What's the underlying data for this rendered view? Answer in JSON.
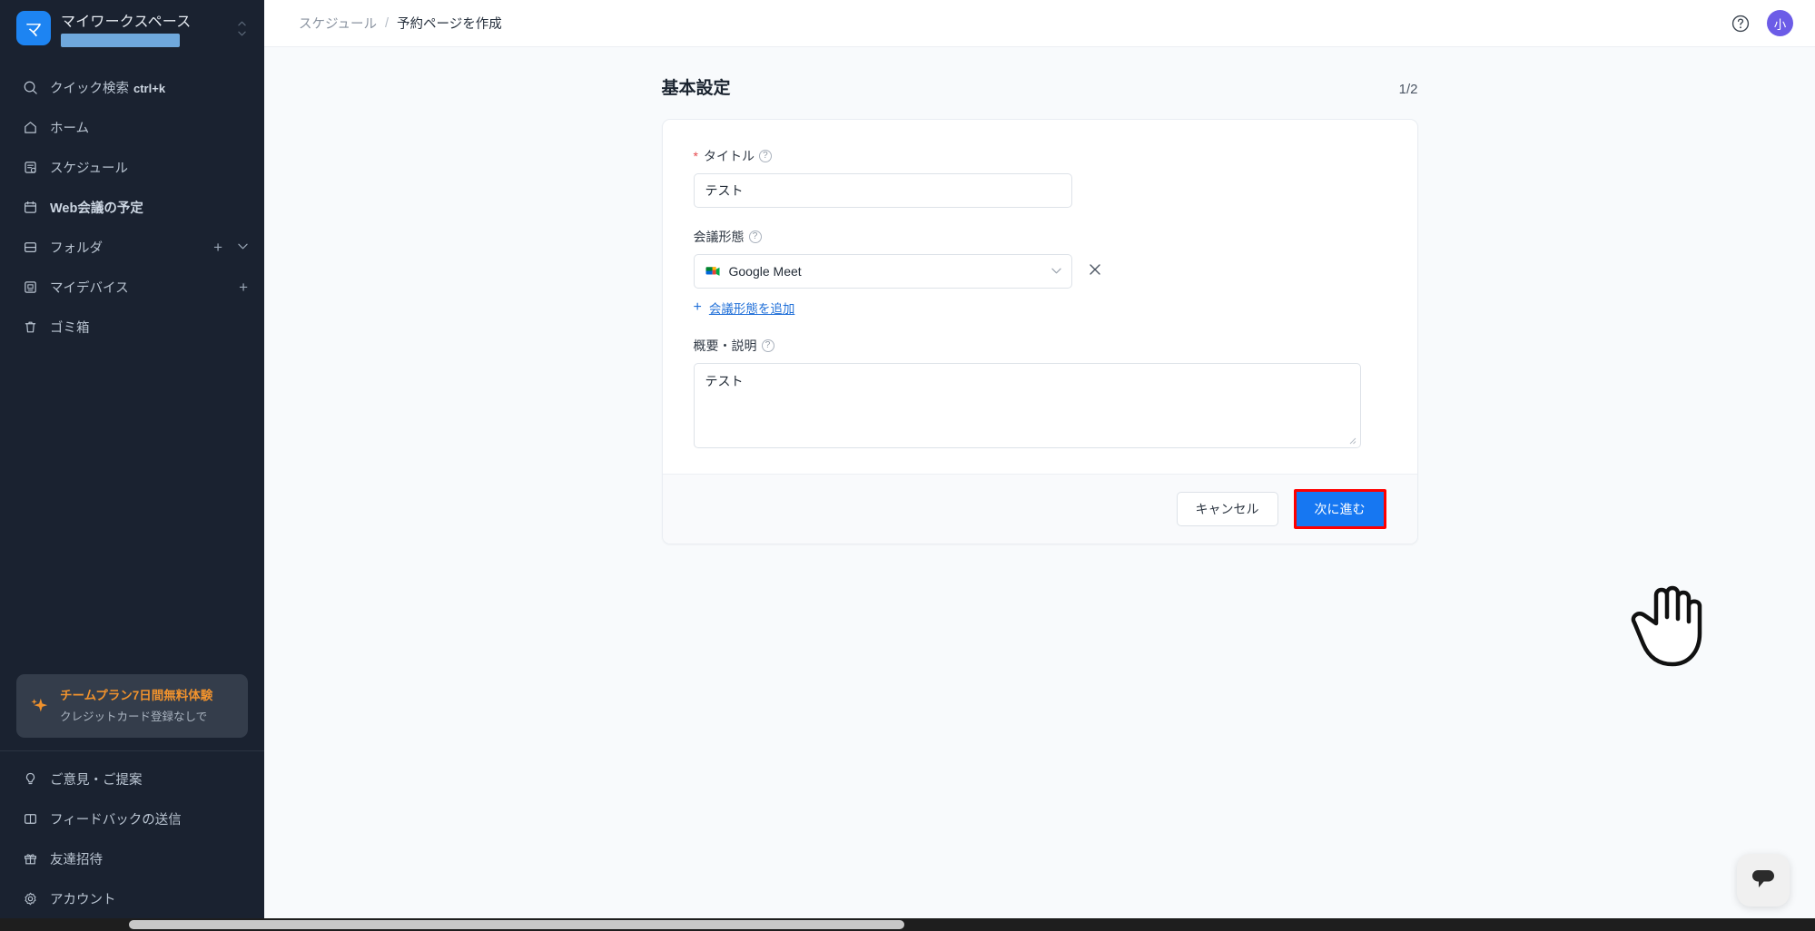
{
  "sidebar": {
    "workspace": {
      "logo_glyph": "マ",
      "name": "マイワークスペース",
      "redacted_bar": true,
      "collapse_icon": "chevron-updown-icon"
    },
    "items": [
      {
        "icon": "search-icon",
        "label": "クイック検索",
        "hint": "ctrl+k",
        "bold": false,
        "plus": false,
        "chevron": false
      },
      {
        "icon": "home-icon",
        "label": "ホーム",
        "hint": "",
        "bold": false,
        "plus": false,
        "chevron": false
      },
      {
        "icon": "schedule-icon",
        "label": "スケジュール",
        "hint": "",
        "bold": false,
        "plus": false,
        "chevron": false
      },
      {
        "icon": "calendar-icon",
        "label": "Web会議の予定",
        "hint": "",
        "bold": true,
        "plus": false,
        "chevron": false
      },
      {
        "icon": "folder-icon",
        "label": "フォルダ",
        "hint": "",
        "bold": false,
        "plus": true,
        "chevron": true
      },
      {
        "icon": "device-icon",
        "label": "マイデバイス",
        "hint": "",
        "bold": false,
        "plus": true,
        "chevron": false
      },
      {
        "icon": "trash-icon",
        "label": "ゴミ箱",
        "hint": "",
        "bold": false,
        "plus": false,
        "chevron": false
      }
    ],
    "promo": {
      "icon": "sparkle-icon",
      "title": "チームプラン7日間無料体験",
      "subtitle": "クレジットカード登録なしで",
      "title_color": "#f0922d"
    },
    "bottom_items": [
      {
        "icon": "lightbulb-icon",
        "label": "ご意見・ご提案"
      },
      {
        "icon": "feedback-icon",
        "label": "フィードバックの送信"
      },
      {
        "icon": "gift-icon",
        "label": "友達招待"
      },
      {
        "icon": "gear-icon",
        "label": "アカウント"
      }
    ]
  },
  "topbar": {
    "breadcrumb": {
      "parent": "スケジュール",
      "separator": "/",
      "current": "予約ページを作成"
    },
    "help_icon": "question-circle-icon",
    "avatar": {
      "initial": "小",
      "color": "#6c5ce7"
    }
  },
  "page": {
    "title": "基本設定",
    "step": "1/2"
  },
  "form": {
    "title_field": {
      "label": "タイトル",
      "required_marker": "*",
      "help_icon": "question-circle-icon",
      "value": "テスト",
      "placeholder": ""
    },
    "meeting_type_field": {
      "label": "会議形態",
      "help_icon": "question-circle-icon",
      "selected": "Google Meet",
      "provider_icon": "google-meet-icon",
      "dropdown_icon": "chevron-down-icon",
      "clear_icon": "close-icon",
      "add_link": {
        "plus": "+",
        "label": "会議形態を追加"
      }
    },
    "description_field": {
      "label": "概要・説明",
      "help_icon": "question-circle-icon",
      "value": "テスト",
      "placeholder": ""
    }
  },
  "footer": {
    "cancel_label": "キャンセル",
    "next_label": "次に進む",
    "next_color": "#1677f2",
    "highlight_color": "#ff0000"
  },
  "overlay": {
    "cursor": "pointing-hand-cursor",
    "chat_icon": "chat-bubble-icon"
  }
}
